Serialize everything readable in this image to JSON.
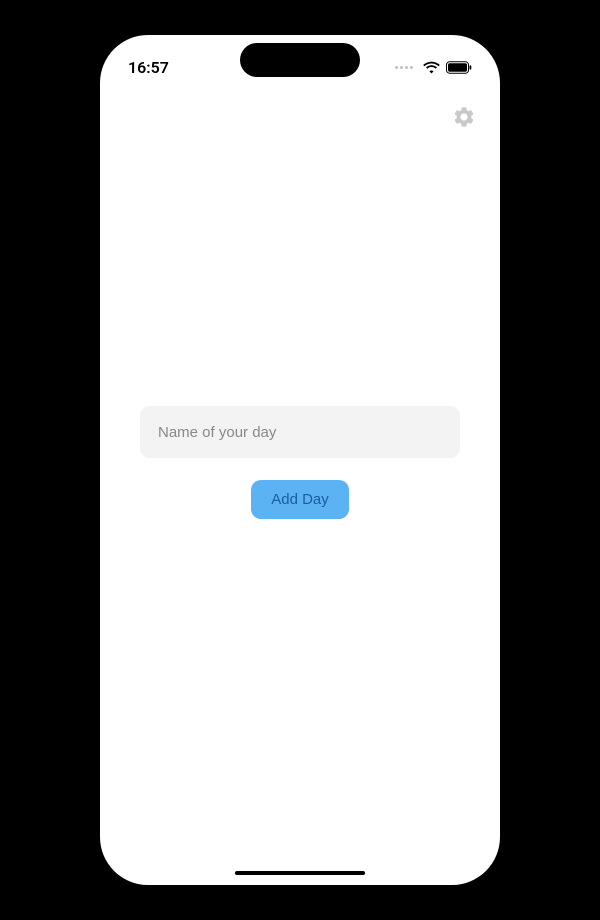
{
  "statusBar": {
    "time": "16:57"
  },
  "main": {
    "inputPlaceholder": "Name of your day",
    "inputValue": "",
    "addButtonLabel": "Add Day"
  }
}
